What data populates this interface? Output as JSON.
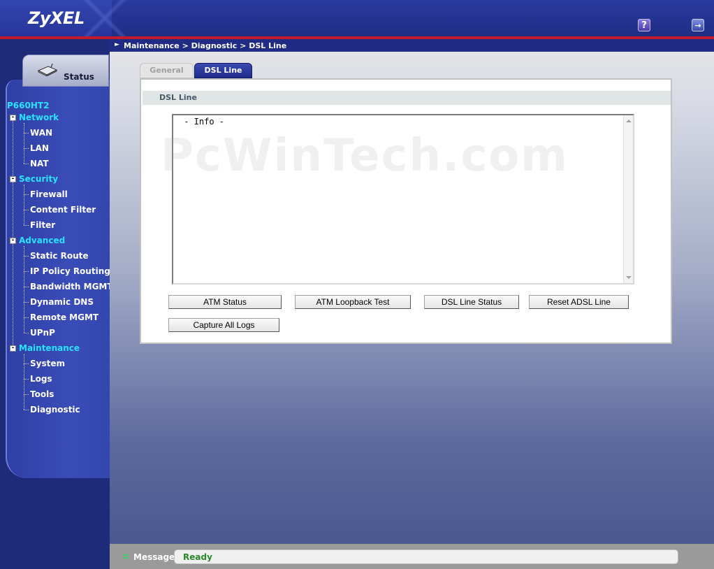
{
  "header": {
    "logo": "ZyXEL",
    "help_icon": "?",
    "logout_icon": "→"
  },
  "sidebar": {
    "status_tab": "Status",
    "model": "P660HT2",
    "categories": [
      {
        "label": "Network",
        "items": [
          "WAN",
          "LAN",
          "NAT"
        ]
      },
      {
        "label": "Security",
        "items": [
          "Firewall",
          "Content Filter",
          "Filter"
        ]
      },
      {
        "label": "Advanced",
        "items": [
          "Static Route",
          "IP Policy Routing",
          "Bandwidth MGMT",
          "Dynamic DNS",
          "Remote MGMT",
          "UPnP"
        ]
      },
      {
        "label": "Maintenance",
        "items": [
          "System",
          "Logs",
          "Tools",
          "Diagnostic"
        ]
      }
    ]
  },
  "breadcrumb": "Maintenance > Diagnostic > DSL Line",
  "tabs": [
    {
      "label": "General",
      "active": false
    },
    {
      "label": "DSL Line",
      "active": true
    }
  ],
  "panel": {
    "title": "DSL Line",
    "info_text": " - Info -",
    "watermark": "PcWinTech.com",
    "buttons": {
      "atm_status": "ATM Status",
      "atm_loopback": "ATM Loopback Test",
      "dsl_line_status": "DSL Line Status",
      "reset_adsl": "Reset ADSL Line",
      "capture_logs": "Capture All Logs"
    }
  },
  "statusbar": {
    "label": "Message",
    "value": "Ready"
  },
  "colors": {
    "accent_cyan": "#29e3ff",
    "header_blue": "#1f2d86",
    "red_bar": "#c21a2a",
    "ready_green": "#2a8a2a"
  }
}
